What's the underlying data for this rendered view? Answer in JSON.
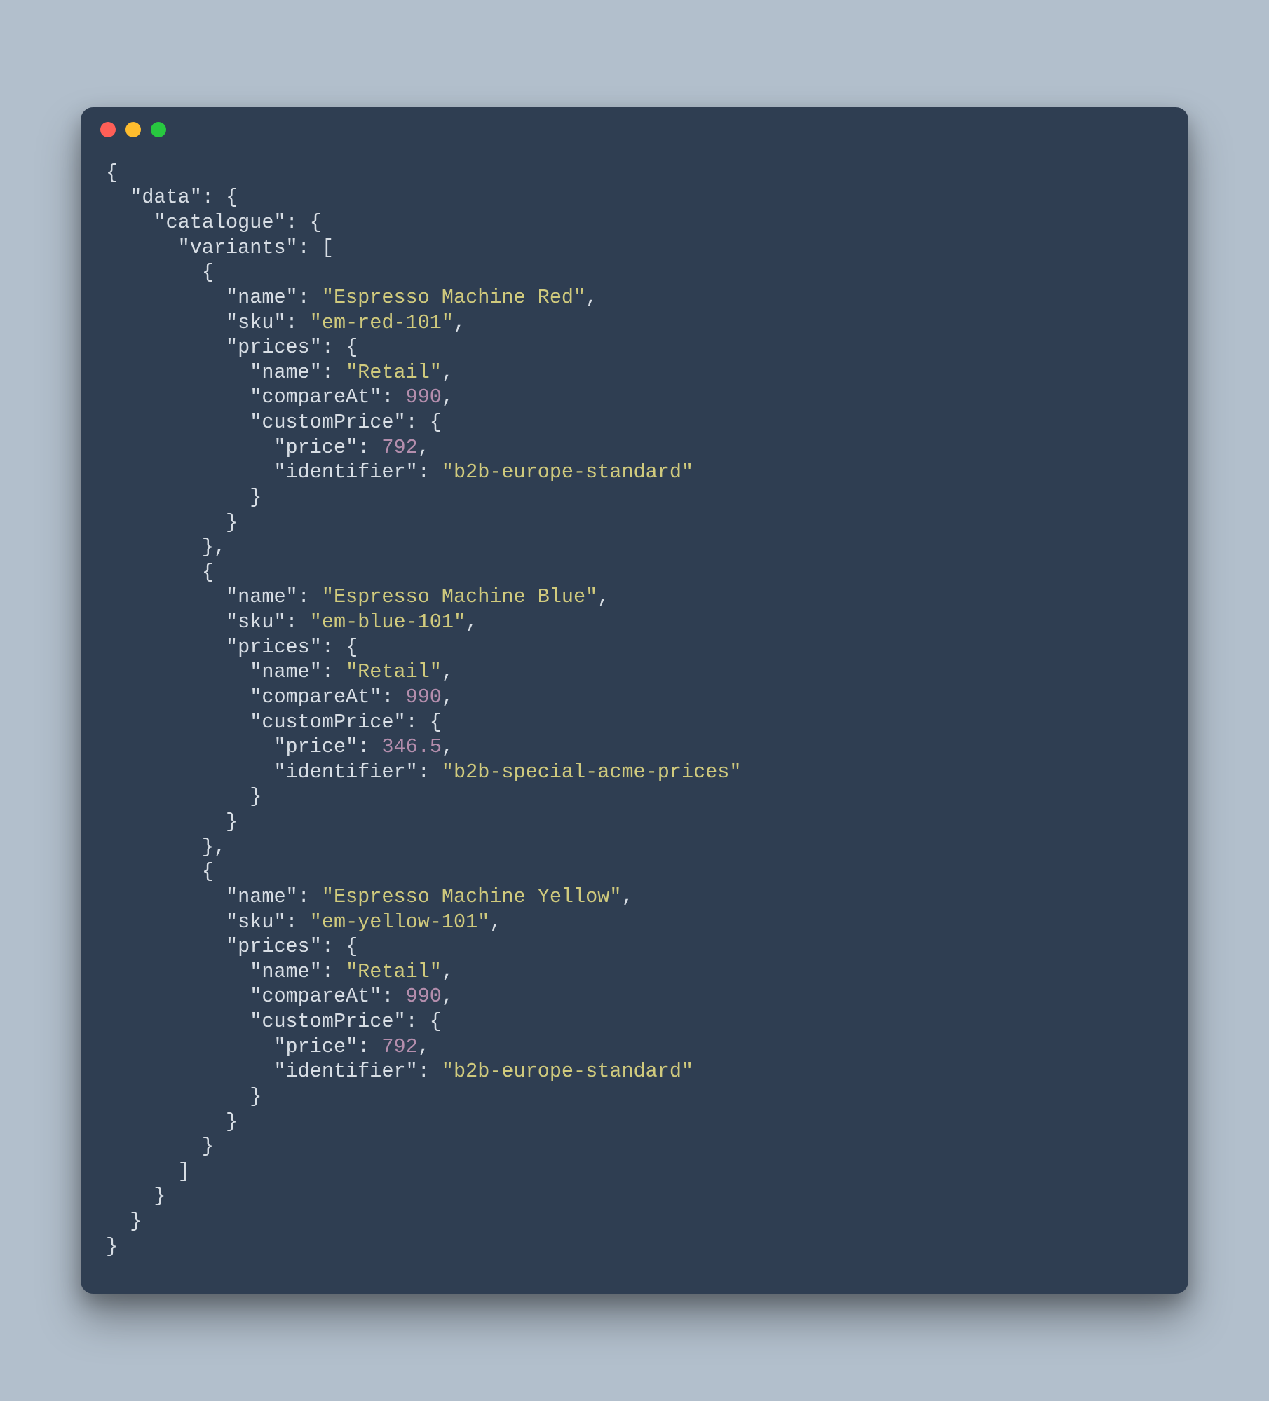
{
  "window": {
    "traffic_lights": [
      "close",
      "minimize",
      "zoom"
    ]
  },
  "code": {
    "data": {
      "catalogue": {
        "variants": [
          {
            "name": "Espresso Machine Red",
            "sku": "em-red-101",
            "prices": {
              "name": "Retail",
              "compareAt": 990,
              "customPrice": {
                "price": 792,
                "identifier": "b2b-europe-standard"
              }
            }
          },
          {
            "name": "Espresso Machine Blue",
            "sku": "em-blue-101",
            "prices": {
              "name": "Retail",
              "compareAt": 990,
              "customPrice": {
                "price": 346.5,
                "identifier": "b2b-special-acme-prices"
              }
            }
          },
          {
            "name": "Espresso Machine Yellow",
            "sku": "em-yellow-101",
            "prices": {
              "name": "Retail",
              "compareAt": 990,
              "customPrice": {
                "price": 792,
                "identifier": "b2b-europe-standard"
              }
            }
          }
        ]
      }
    }
  },
  "colors": {
    "background": "#b2bfcc",
    "window_bg": "#2f3e52",
    "text": "#d7dde4",
    "string": "#d0ca7d",
    "number": "#b48ead"
  }
}
